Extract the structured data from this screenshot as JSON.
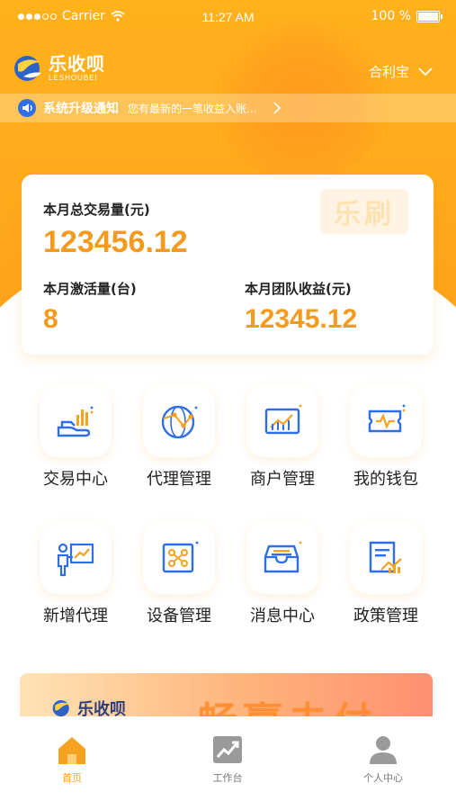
{
  "status_bar": {
    "carrier": "Carrier",
    "time": "11:27 AM",
    "battery": "100 %"
  },
  "header": {
    "logo_cn": "乐收呗",
    "logo_en": "LESHOUBEI",
    "account": "合利宝"
  },
  "notice": {
    "title": "系统升级通知",
    "message": "您有最新的一笔收益入账..."
  },
  "stats": {
    "watermark": "乐刷",
    "total_label": "本月总交易量(元)",
    "total_value": "123456.12",
    "activation_label": "本月激活量(台)",
    "activation_value": "8",
    "team_label": "本月团队收益(元)",
    "team_value": "12345.12"
  },
  "menu": [
    {
      "label": "交易中心",
      "icon": "hand-chart-icon"
    },
    {
      "label": "代理管理",
      "icon": "globe-network-icon"
    },
    {
      "label": "商户管理",
      "icon": "monitor-chart-icon"
    },
    {
      "label": "我的钱包",
      "icon": "wallet-ticket-icon"
    },
    {
      "label": "新增代理",
      "icon": "presenter-icon"
    },
    {
      "label": "设备管理",
      "icon": "device-nodes-icon"
    },
    {
      "label": "消息中心",
      "icon": "inbox-tray-icon"
    },
    {
      "label": "政策管理",
      "icon": "document-chart-icon"
    }
  ],
  "banner": {
    "logo": "乐收呗",
    "headline": "畅赢未付"
  },
  "tabs": [
    {
      "label": "首页",
      "active": true
    },
    {
      "label": "工作台",
      "active": false
    },
    {
      "label": "个人中心",
      "active": false
    }
  ],
  "colors": {
    "accent": "#f49a1f",
    "brand_orange": "#ffa91c",
    "icon_blue": "#2f6ee6",
    "tab_active": "#f5a21f",
    "tab_inactive": "#9a9a9a"
  }
}
